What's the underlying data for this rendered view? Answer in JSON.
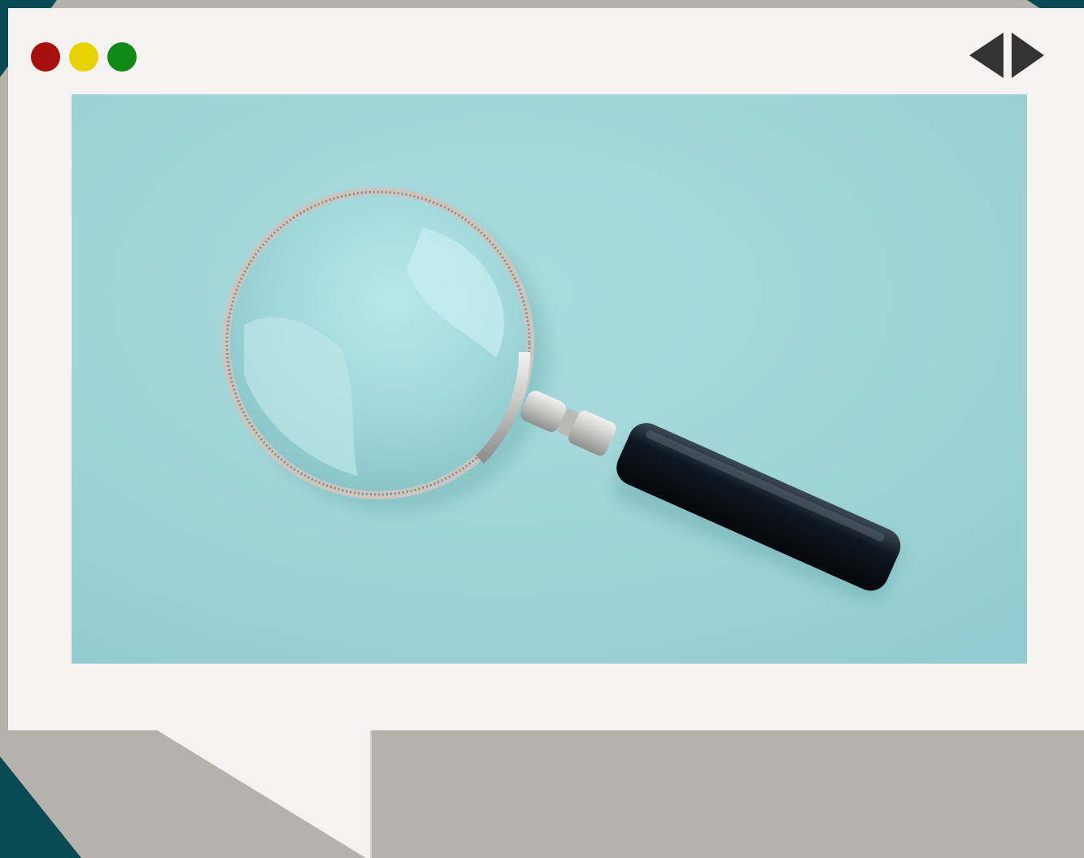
{
  "window_controls": {
    "close_color": "#a80f0f",
    "minimize_color": "#e6d200",
    "maximize_color": "#0f8a17"
  },
  "navigation": {
    "icon": "left-right-arrows-icon",
    "color": "#333333"
  },
  "content": {
    "image": "magnifying-glass-on-aqua-paper",
    "paper_color": "#9fd5d8",
    "frame_color": "#f4f3f1",
    "backdrop_color": "#b5b2ad"
  }
}
